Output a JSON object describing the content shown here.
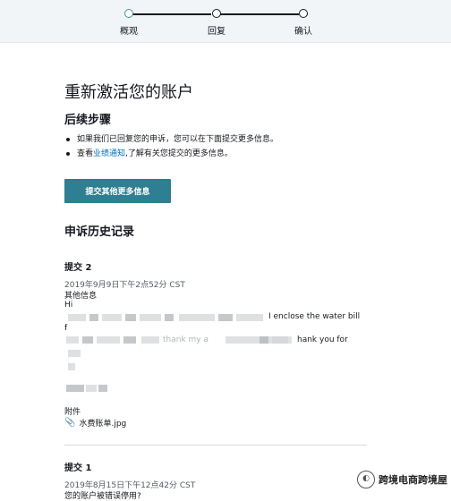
{
  "stepper": {
    "steps": [
      {
        "label": "概观",
        "state": "current"
      },
      {
        "label": "回复",
        "state": "pending"
      },
      {
        "label": "确认",
        "state": "pending"
      }
    ]
  },
  "page": {
    "title": "重新激活您的账户",
    "next_steps_heading": "后续步骤",
    "bullet1": "如果我们已回复您的申诉，您可以在下面提交更多信息。",
    "bullet2_prefix": "查看",
    "bullet2_link": "业绩通知",
    "bullet2_suffix": ",了解有关您提交的更多信息。",
    "submit_more_button": "提交其他更多信息",
    "history_heading": "申诉历史记录"
  },
  "submissions": [
    {
      "heading": "提交 2",
      "timestamp": "2019年9月9日下午2点52分 CST",
      "type": "其他信息",
      "greeting": "Hi",
      "line1_tail": "I enclose the water bill",
      "line2_start": "f",
      "line3_mid": "thank my a",
      "line3_tail": "hank you for",
      "attachments_label": "附件",
      "attachment_name": "水费账单.jpg"
    },
    {
      "heading": "提交 1",
      "timestamp": "2019年8月15日下午12点42分 CST",
      "type": "您的账户被错误停用?"
    }
  ],
  "watermark": {
    "text": "跨境电商跨境屋"
  },
  "colors": {
    "accent": "#2e7f91",
    "link": "#0073bb",
    "active_step": "#4a90a8"
  }
}
